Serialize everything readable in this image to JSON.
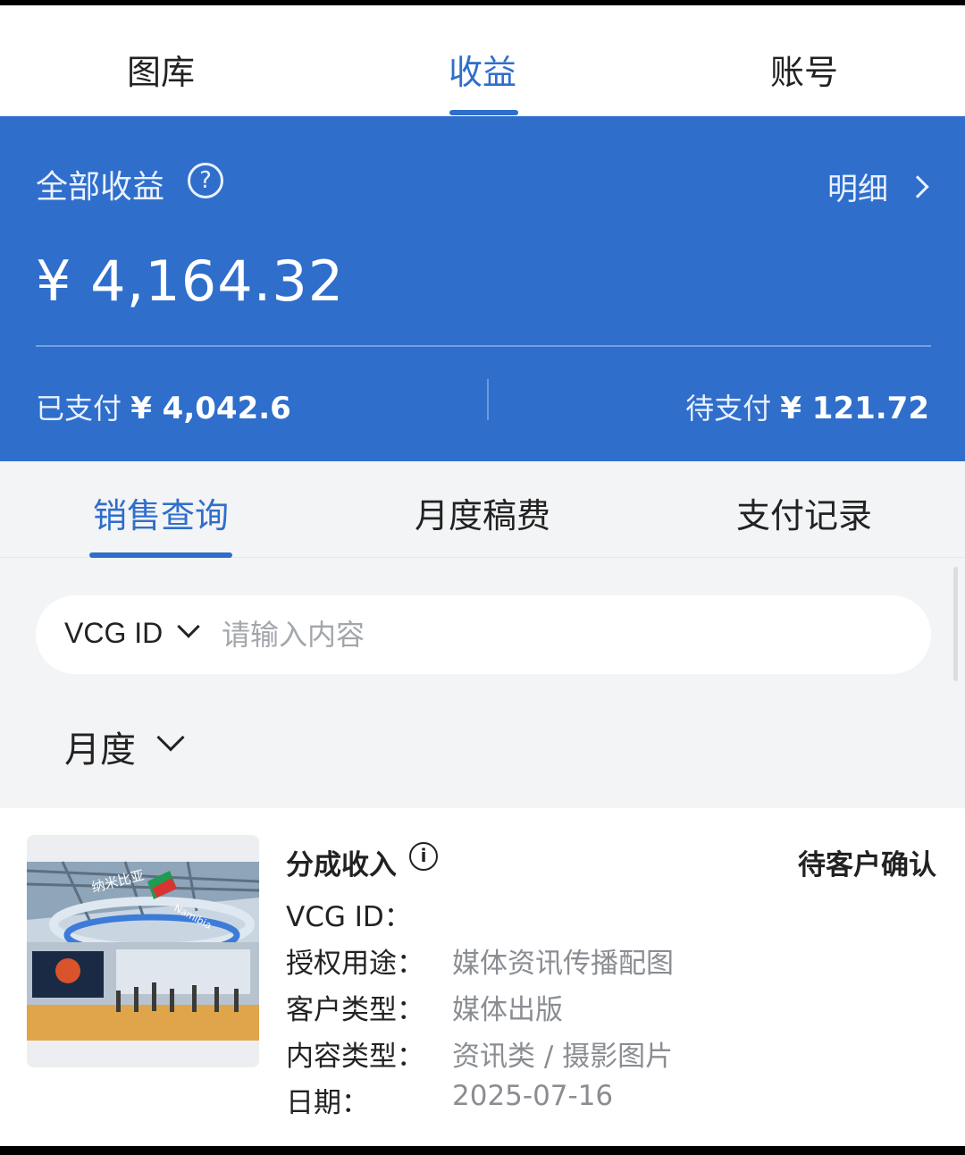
{
  "top_tabs": [
    "图库",
    "收益",
    "账号"
  ],
  "summary": {
    "title": "全部收益",
    "help": "?",
    "detail": "明细",
    "total": "¥ 4,164.32",
    "paid_label": "已支付",
    "paid_amount": "¥ 4,042.6",
    "pending_label": "待支付",
    "pending_amount": "¥ 121.72"
  },
  "sub_tabs": [
    "销售查询",
    "月度稿费",
    "支付记录"
  ],
  "search": {
    "type": "VCG ID",
    "placeholder": "请输入内容"
  },
  "filter": {
    "month": "月度"
  },
  "card": {
    "title": "分成收入",
    "info": "i",
    "status": "待客户确认",
    "rows": [
      {
        "label": "VCG ID：",
        "value": ""
      },
      {
        "label": "授权用途：",
        "value": "媒体资讯传播配图"
      },
      {
        "label": "客户类型：",
        "value": "媒体出版"
      },
      {
        "label": "内容类型：",
        "value": "资讯类 / 摄影图片"
      },
      {
        "label": "日期：",
        "value": "2025-07-16"
      }
    ],
    "thumb_sign": "纳米比亚",
    "thumb_sign2": "Namibia"
  },
  "colors": {
    "accent": "#2f6ecb",
    "text": "#222222",
    "muted": "#8a8d92"
  }
}
